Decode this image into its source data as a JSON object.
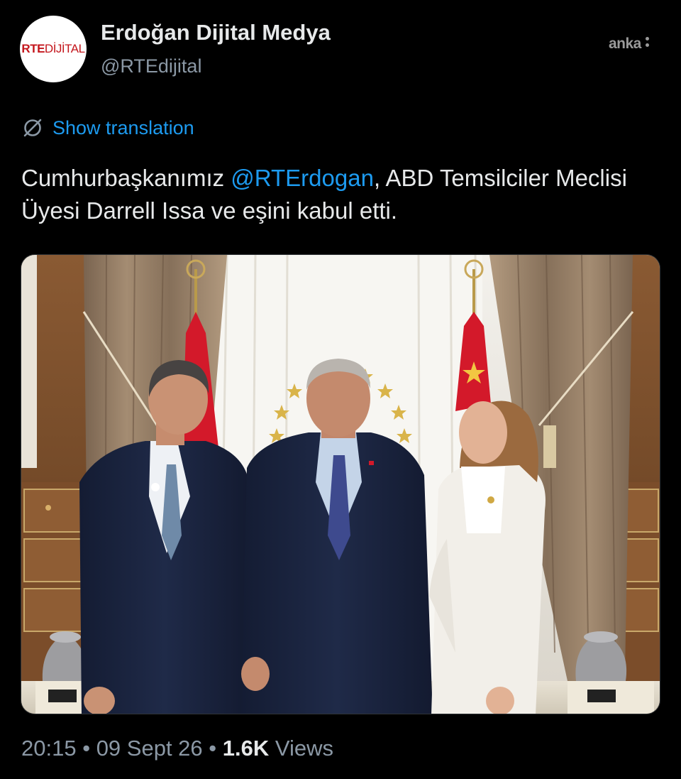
{
  "tweet": {
    "author": {
      "display_name": "Erdoğan Dijital Medya",
      "handle": "@RTEdijital",
      "avatar_logo_bold": "RTE",
      "avatar_logo_light": "DİJİTAL"
    },
    "watermark": "anka",
    "translate_label": "Show translation",
    "text_before_mention": "Cumhurbaşkanımız ",
    "mention": "@RTErdogan",
    "text_after_mention": ", ABD Temsilciler Meclisi Üyesi Darrell Issa ve eşini kabul etti.",
    "time": "20:15",
    "separator": "•",
    "date": "09 Sept 26",
    "views_count": "1.6K",
    "views_label": "Views"
  },
  "colors": {
    "background": "#000000",
    "text_primary": "#e7e9ea",
    "text_secondary": "#8b98a5",
    "link": "#1d9bf0",
    "brand_red": "#c4161c"
  },
  "icons": {
    "translate": "globe-slash-icon"
  }
}
